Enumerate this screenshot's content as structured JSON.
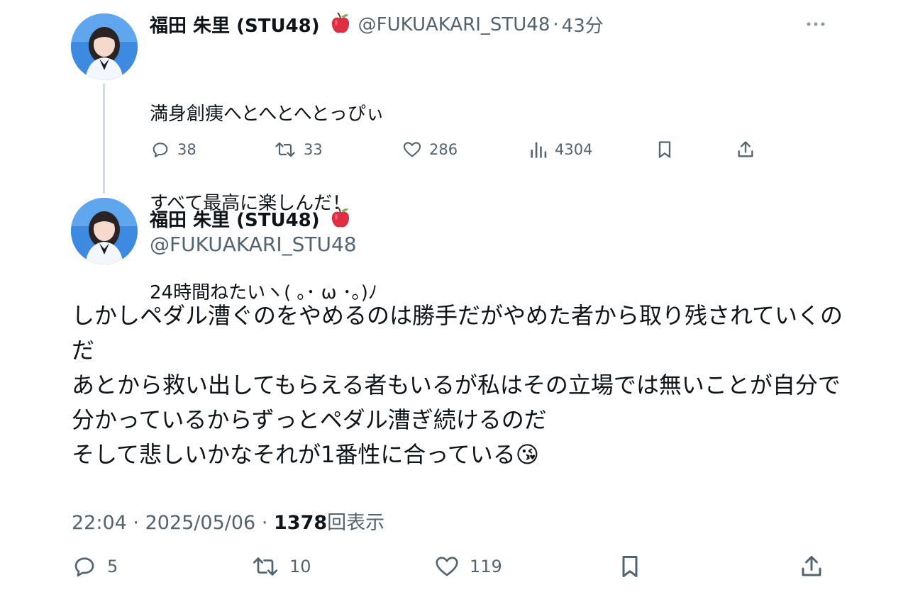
{
  "reply": {
    "author_name": "福田 朱里 (STU48)",
    "author_handle": "@FUKUAKARI_STU48",
    "separator": "·",
    "time_ago": "43分",
    "lines": [
      "満身創痍へとへとへとっぴぃ",
      "すべて最高に楽しんだ！",
      "24時間ねたいヽ( ｡･ ω ･｡)ﾉ"
    ],
    "actions": {
      "replies": "38",
      "reposts": "33",
      "likes": "286",
      "views": "4304"
    }
  },
  "main": {
    "author_name": "福田 朱里 (STU48)",
    "author_handle": "@FUKUAKARI_STU48",
    "lines": [
      "しかしペダル漕ぐのをやめるのは勝手だがやめた者から取り残されていくの",
      "だ",
      "あとから救い出してもらえる者もいるが私はその立場では無いことが自分で",
      "分かっているからずっとペダル漕ぎ続けるのだ",
      "そして悲しいかなそれが1番性に合っている😘"
    ],
    "time": "22:04",
    "date": "2025/05/06",
    "meta_separator": "·",
    "view_count": "1378",
    "view_label": "回表示",
    "actions": {
      "replies": "5",
      "reposts": "10",
      "likes": "119"
    }
  },
  "icons": {
    "emoji_after_name": "red-apple-icon",
    "more": "more-icon"
  }
}
